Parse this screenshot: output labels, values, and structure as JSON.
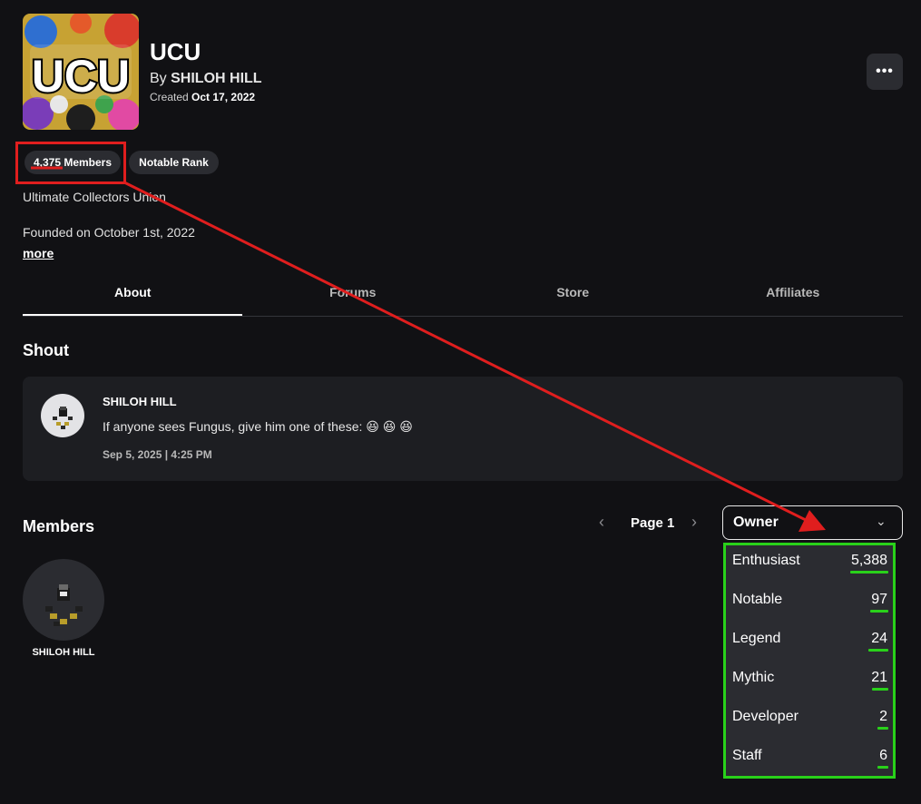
{
  "group": {
    "name": "UCU",
    "by_prefix": "By",
    "owner": "SHILOH HILL",
    "created_prefix": "Created",
    "created_date": "Oct 17, 2022",
    "icon_text": "UCU"
  },
  "more_button": "•••",
  "badges": {
    "members": "4,375 Members",
    "rank": "Notable Rank"
  },
  "description": {
    "line1": "Ultimate Collectors Union",
    "line2": "Founded on October 1st, 2022",
    "more": "more"
  },
  "tabs": [
    {
      "label": "About",
      "active": true
    },
    {
      "label": "Forums",
      "active": false
    },
    {
      "label": "Store",
      "active": false
    },
    {
      "label": "Affiliates",
      "active": false
    }
  ],
  "shout": {
    "title": "Shout",
    "user": "SHILOH HILL",
    "text": "If anyone sees Fungus, give him one of these: 😆 😆 😆",
    "date": "Sep 5, 2025 | 4:25 PM"
  },
  "members": {
    "title": "Members",
    "page_label": "Page 1",
    "prev_icon": "chevron-left-icon",
    "next_icon": "chevron-right-icon",
    "selected_role": "Owner",
    "list": [
      {
        "name": "SHILOH HILL"
      }
    ]
  },
  "role_options": [
    {
      "name": "Enthusiast",
      "count": "5,388"
    },
    {
      "name": "Notable",
      "count": "97"
    },
    {
      "name": "Legend",
      "count": "24"
    },
    {
      "name": "Mythic",
      "count": "21"
    },
    {
      "name": "Developer",
      "count": "2"
    },
    {
      "name": "Staff",
      "count": "6"
    }
  ],
  "colors": {
    "background": "#111114",
    "card": "#1d1e22",
    "pill": "#2b2c31",
    "annotation_red": "#e01e1e",
    "annotation_green": "#29d11a"
  }
}
